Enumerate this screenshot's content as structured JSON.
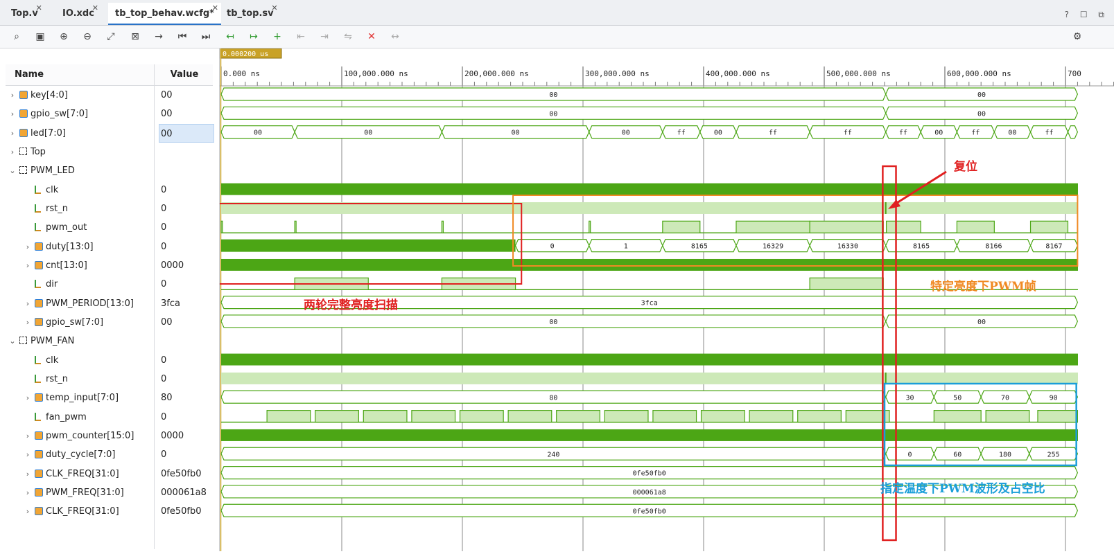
{
  "tabs": [
    {
      "label": "Top.v"
    },
    {
      "label": "IO.xdc"
    },
    {
      "label": "tb_top_behav.wcfg*",
      "active": true
    },
    {
      "label": "tb_top.sv"
    }
  ],
  "window_icons": "? ☐ ⧉",
  "toolbar_icons": [
    "search-icon",
    "save-icon",
    "zoom-in-icon",
    "zoom-out-icon",
    "zoom-fit-icon",
    "zoom-full-icon",
    "go-to-cursor-icon",
    "go-to-start-icon",
    "go-to-end-icon",
    "prev-transition-icon",
    "next-transition-icon",
    "add-marker-icon",
    "prev-marker-icon",
    "next-marker-icon",
    "swap-cursors-icon",
    "delete-markers-icon",
    "snap-icon"
  ],
  "columns": {
    "name": "Name",
    "value": "Value"
  },
  "cursor_label": "0.000200 us",
  "time_axis": {
    "unit": "ns",
    "labels": [
      "0.000 ns",
      "100,000.000 ns",
      "200,000.000 ns",
      "300,000.000 ns",
      "400,000.000 ns",
      "500,000.000 ns",
      "600,000.000 ns",
      "700"
    ]
  },
  "colors": {
    "wave": "#4ca615",
    "wave_fill": "#cde9b8",
    "annotation_red": "#e02020",
    "annotation_orange": "#f08a24",
    "annotation_blue": "#1a9ed8"
  },
  "signals": [
    {
      "name": "key[4:0]",
      "value": "00",
      "kind": "bus",
      "indent": 0,
      "expand": "collapsed"
    },
    {
      "name": "gpio_sw[7:0]",
      "value": "00",
      "kind": "bus",
      "indent": 0,
      "expand": "collapsed"
    },
    {
      "name": "led[7:0]",
      "value": "00",
      "kind": "bus",
      "indent": 0,
      "expand": "collapsed",
      "selected": true
    },
    {
      "name": "Top",
      "value": "",
      "kind": "scope",
      "indent": 0,
      "expand": "collapsed"
    },
    {
      "name": "PWM_LED",
      "value": "",
      "kind": "scope",
      "indent": 0,
      "expand": "expanded"
    },
    {
      "name": "clk",
      "value": "0",
      "kind": "bit",
      "indent": 1,
      "expand": "none"
    },
    {
      "name": "rst_n",
      "value": "0",
      "kind": "bit",
      "indent": 1,
      "expand": "none"
    },
    {
      "name": "pwm_out",
      "value": "0",
      "kind": "bit",
      "indent": 1,
      "expand": "none"
    },
    {
      "name": "duty[13:0]",
      "value": "0",
      "kind": "bus",
      "indent": 1,
      "expand": "collapsed"
    },
    {
      "name": "cnt[13:0]",
      "value": "0000",
      "kind": "bus",
      "indent": 1,
      "expand": "collapsed"
    },
    {
      "name": "dir",
      "value": "0",
      "kind": "bit",
      "indent": 1,
      "expand": "none"
    },
    {
      "name": "PWM_PERIOD[13:0]",
      "value": "3fca",
      "kind": "bus",
      "indent": 1,
      "expand": "collapsed"
    },
    {
      "name": "gpio_sw[7:0]",
      "value": "00",
      "kind": "bus",
      "indent": 1,
      "expand": "collapsed"
    },
    {
      "name": "PWM_FAN",
      "value": "",
      "kind": "scope",
      "indent": 0,
      "expand": "expanded"
    },
    {
      "name": "clk",
      "value": "0",
      "kind": "bit",
      "indent": 1,
      "expand": "none"
    },
    {
      "name": "rst_n",
      "value": "0",
      "kind": "bit",
      "indent": 1,
      "expand": "none"
    },
    {
      "name": "temp_input[7:0]",
      "value": "80",
      "kind": "bus",
      "indent": 1,
      "expand": "collapsed"
    },
    {
      "name": "fan_pwm",
      "value": "0",
      "kind": "bit",
      "indent": 1,
      "expand": "none"
    },
    {
      "name": "pwm_counter[15:0]",
      "value": "0000",
      "kind": "bus",
      "indent": 1,
      "expand": "collapsed"
    },
    {
      "name": "duty_cycle[7:0]",
      "value": "0",
      "kind": "bus",
      "indent": 1,
      "expand": "collapsed"
    },
    {
      "name": "CLK_FREQ[31:0]",
      "value": "0fe50fb0",
      "kind": "bus",
      "indent": 1,
      "expand": "collapsed"
    },
    {
      "name": "PWM_FREQ[31:0]",
      "value": "000061a8",
      "kind": "bus",
      "indent": 1,
      "expand": "collapsed"
    },
    {
      "name": "CLK_FREQ[31:0]",
      "value": "0fe50fb0",
      "kind": "bus",
      "indent": 1,
      "expand": "collapsed"
    }
  ],
  "waves": [
    {
      "type": "bus",
      "segments": [
        {
          "t0": 0,
          "t1": 551000,
          "v": "00"
        },
        {
          "t0": 551000,
          "t1": 710000,
          "v": "00"
        }
      ]
    },
    {
      "type": "bus",
      "segments": [
        {
          "t0": 0,
          "t1": 551000,
          "v": "00"
        },
        {
          "t0": 551000,
          "t1": 710000,
          "v": "00"
        }
      ]
    },
    {
      "type": "bus",
      "segments": [
        {
          "t0": 0,
          "t1": 61000,
          "v": "00"
        },
        {
          "t0": 61000,
          "t1": 183000,
          "v": "00"
        },
        {
          "t0": 183000,
          "t1": 305000,
          "v": "00"
        },
        {
          "t0": 305000,
          "t1": 366000,
          "v": "00"
        },
        {
          "t0": 366000,
          "t1": 397000,
          "v": "ff"
        },
        {
          "t0": 397000,
          "t1": 427000,
          "v": "00"
        },
        {
          "t0": 427000,
          "t1": 488000,
          "v": "ff"
        },
        {
          "t0": 488000,
          "t1": 551000,
          "v": "ff"
        },
        {
          "t0": 551000,
          "t1": 580000,
          "v": "ff"
        },
        {
          "t0": 580000,
          "t1": 610000,
          "v": "00"
        },
        {
          "t0": 610000,
          "t1": 641000,
          "v": "ff"
        },
        {
          "t0": 641000,
          "t1": 671000,
          "v": "00"
        },
        {
          "t0": 671000,
          "t1": 702000,
          "v": "ff"
        },
        {
          "t0": 702000,
          "t1": 710000,
          "v": ""
        }
      ]
    },
    {
      "type": "empty"
    },
    {
      "type": "empty"
    },
    {
      "type": "clock"
    },
    {
      "type": "rst",
      "rise": 551000
    },
    {
      "type": "bit",
      "high": [
        [
          0,
          800
        ],
        [
          61000,
          62000
        ],
        [
          183000,
          184000
        ],
        [
          305000,
          306000
        ],
        [
          366000,
          397000
        ],
        [
          427000,
          488000
        ],
        [
          488000,
          549000
        ],
        [
          551500,
          580000
        ],
        [
          610000,
          641000
        ],
        [
          671000,
          702000
        ]
      ]
    },
    {
      "type": "bus",
      "pre_solid_until": 244000,
      "segments": [
        {
          "t0": 244000,
          "t1": 305000,
          "v": "0"
        },
        {
          "t0": 305000,
          "t1": 366000,
          "v": "1"
        },
        {
          "t0": 366000,
          "t1": 427000,
          "v": "8165"
        },
        {
          "t0": 427000,
          "t1": 488000,
          "v": "16329"
        },
        {
          "t0": 488000,
          "t1": 551000,
          "v": "16330"
        },
        {
          "t0": 551000,
          "t1": 610000,
          "v": "8165"
        },
        {
          "t0": 610000,
          "t1": 671000,
          "v": "8166"
        },
        {
          "t0": 671000,
          "t1": 710000,
          "v": "8167"
        }
      ]
    },
    {
      "type": "solid"
    },
    {
      "type": "bit",
      "high": [
        [
          61000,
          122000
        ],
        [
          183000,
          244000
        ],
        [
          488000,
          549000
        ]
      ]
    },
    {
      "type": "bus",
      "segments": [
        {
          "t0": 0,
          "t1": 710000,
          "v": "3fca"
        }
      ]
    },
    {
      "type": "bus",
      "segments": [
        {
          "t0": 0,
          "t1": 551000,
          "v": "00"
        },
        {
          "t0": 551000,
          "t1": 710000,
          "v": "00"
        }
      ]
    },
    {
      "type": "empty"
    },
    {
      "type": "clock"
    },
    {
      "type": "rst",
      "rise": 551000
    },
    {
      "type": "bus",
      "segments": [
        {
          "t0": 0,
          "t1": 551000,
          "v": "80"
        },
        {
          "t0": 551000,
          "t1": 591000,
          "v": "30"
        },
        {
          "t0": 591000,
          "t1": 630000,
          "v": "50"
        },
        {
          "t0": 630000,
          "t1": 670000,
          "v": "70"
        },
        {
          "t0": 670000,
          "t1": 710000,
          "v": "90"
        }
      ]
    },
    {
      "type": "fanpwm"
    },
    {
      "type": "solid"
    },
    {
      "type": "bus",
      "segments": [
        {
          "t0": 0,
          "t1": 551000,
          "v": "240"
        },
        {
          "t0": 551000,
          "t1": 591000,
          "v": "0"
        },
        {
          "t0": 591000,
          "t1": 630000,
          "v": "60"
        },
        {
          "t0": 630000,
          "t1": 670000,
          "v": "180"
        },
        {
          "t0": 670000,
          "t1": 710000,
          "v": "255"
        }
      ]
    },
    {
      "type": "bus",
      "segments": [
        {
          "t0": 0,
          "t1": 710000,
          "v": "0fe50fb0"
        }
      ]
    },
    {
      "type": "bus",
      "segments": [
        {
          "t0": 0,
          "t1": 710000,
          "v": "000061a8"
        }
      ]
    },
    {
      "type": "bus",
      "segments": [
        {
          "t0": 0,
          "t1": 710000,
          "v": "0fe50fb0"
        }
      ]
    }
  ],
  "annotations": {
    "reset": "复位",
    "scan": "两轮完整亮度扫描",
    "pwm_frame": "特定亮度下PWM帧",
    "temp_pwm": "指定温度下PWM波形及占空比"
  }
}
